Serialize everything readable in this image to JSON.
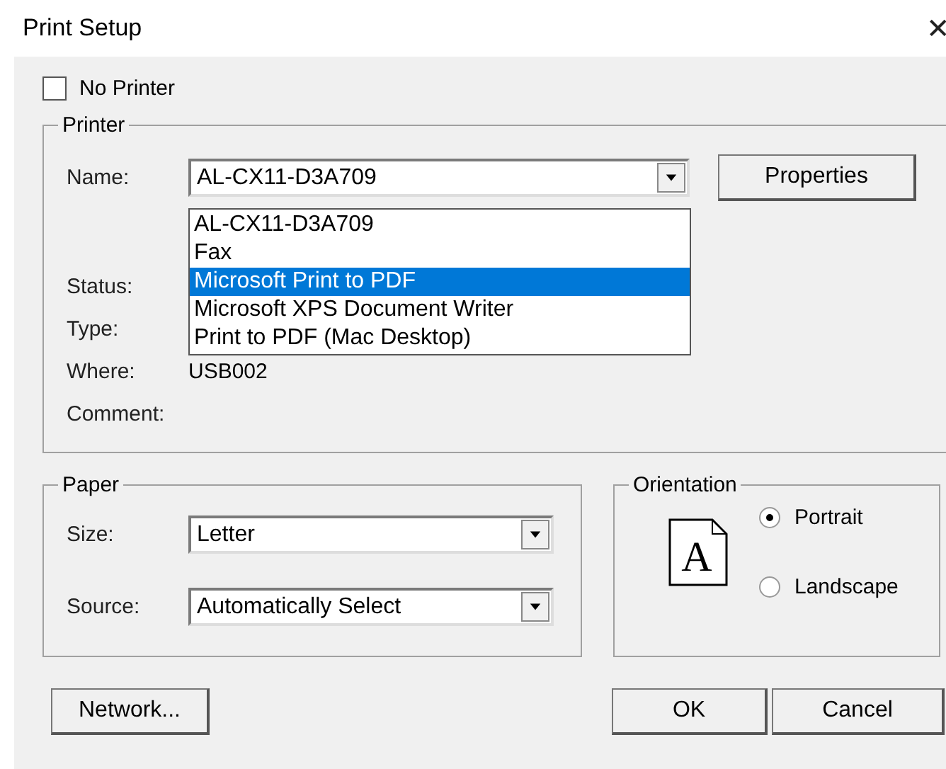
{
  "window": {
    "title": "Print Setup",
    "close": "✕"
  },
  "no_printer": {
    "label": "No Printer",
    "checked": false
  },
  "printer": {
    "title": "Printer",
    "name_label": "Name:",
    "name_value": "AL-CX11-D3A709",
    "properties_button": "Properties",
    "options": [
      {
        "label": "AL-CX11-D3A709",
        "selected": false
      },
      {
        "label": "Fax",
        "selected": false
      },
      {
        "label": "Microsoft Print to PDF",
        "selected": true
      },
      {
        "label": "Microsoft XPS Document Writer",
        "selected": false
      },
      {
        "label": "Print to PDF (Mac Desktop)",
        "selected": false
      }
    ],
    "fields": [
      {
        "label": "Status:"
      },
      {
        "label": "Type:"
      },
      {
        "label": "Where:",
        "value": "USB002"
      },
      {
        "label": "Comment:"
      }
    ]
  },
  "paper": {
    "title": "Paper",
    "size_label": "Size:",
    "size_value": "Letter",
    "source_label": "Source:",
    "source_value": "Automatically Select"
  },
  "orientation": {
    "title": "Orientation",
    "icon_letter": "A",
    "options": [
      {
        "label": "Portrait",
        "selected": true
      },
      {
        "label": "Landscape",
        "selected": false
      }
    ]
  },
  "buttons": {
    "network": "Network...",
    "ok": "OK",
    "cancel": "Cancel"
  }
}
